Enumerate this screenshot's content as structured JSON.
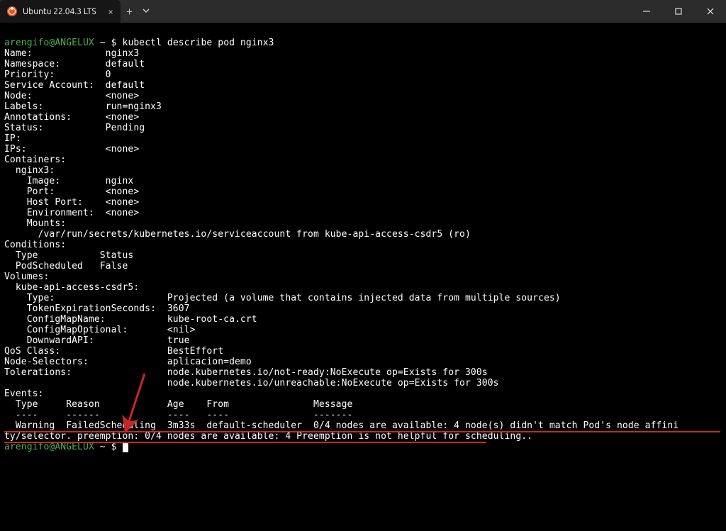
{
  "titlebar": {
    "tab_title": "Ubuntu 22.04.3 LTS"
  },
  "prompt": {
    "user_host": "arengifo@ANGELUX",
    "path": "~",
    "dollar": "$"
  },
  "command": "kubectl describe pod nginx3",
  "output": {
    "lines": [
      "Name:             nginx3",
      "Namespace:        default",
      "Priority:         0",
      "Service Account:  default",
      "Node:             <none>",
      "Labels:           run=nginx3",
      "Annotations:      <none>",
      "Status:           Pending",
      "IP:               ",
      "IPs:              <none>",
      "Containers:",
      "  nginx3:",
      "    Image:        nginx",
      "    Port:         <none>",
      "    Host Port:    <none>",
      "    Environment:  <none>",
      "    Mounts:",
      "      /var/run/secrets/kubernetes.io/serviceaccount from kube-api-access-csdr5 (ro)",
      "Conditions:",
      "  Type           Status",
      "  PodScheduled   False ",
      "Volumes:",
      "  kube-api-access-csdr5:",
      "    Type:                    Projected (a volume that contains injected data from multiple sources)",
      "    TokenExpirationSeconds:  3607",
      "    ConfigMapName:           kube-root-ca.crt",
      "    ConfigMapOptional:       <nil>",
      "    DownwardAPI:             true",
      "QoS Class:                   BestEffort",
      "Node-Selectors:              aplicacion=demo",
      "Tolerations:                 node.kubernetes.io/not-ready:NoExecute op=Exists for 300s",
      "                             node.kubernetes.io/unreachable:NoExecute op=Exists for 300s",
      "Events:",
      "  Type     Reason            Age    From               Message",
      "  ----     ------            ----   ----               -------",
      "  Warning  FailedScheduling  3m33s  default-scheduler  0/4 nodes are available: 4 node(s) didn't match Pod's node affini",
      "ty/selector. preemption: 0/4 nodes are available: 4 Preemption is not helpful for scheduling.."
    ]
  }
}
